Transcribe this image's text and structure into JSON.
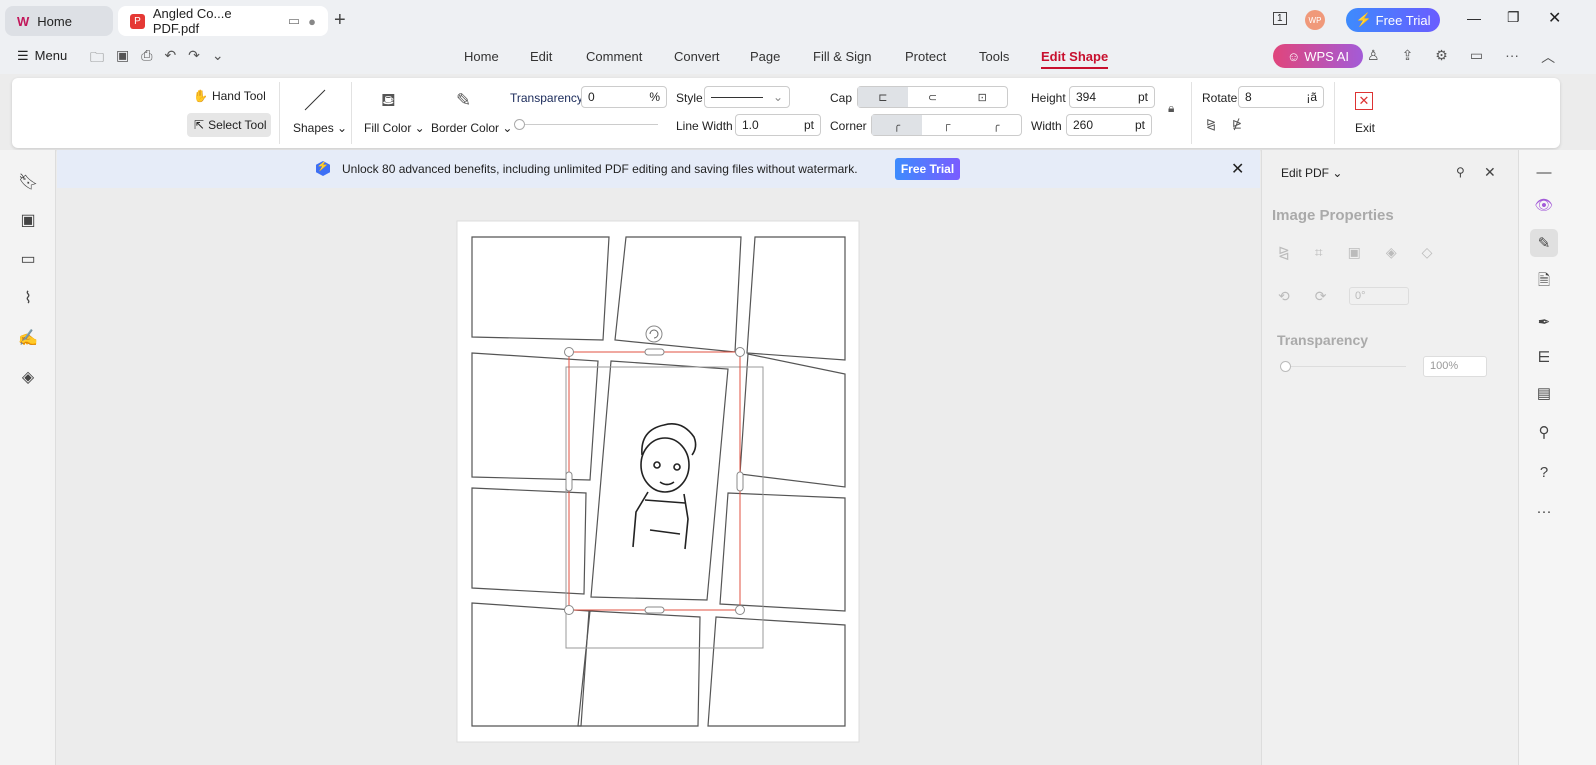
{
  "tabs": [
    {
      "label": "Home"
    },
    {
      "label": "Angled Co...e PDF.pdf"
    }
  ],
  "titlebar": {
    "free_trial": "Free Trial",
    "avatar": "WP",
    "page_indicator": "1"
  },
  "menu": {
    "menu_label": "Menu",
    "items": [
      "Home",
      "Edit",
      "Comment",
      "Convert",
      "Page",
      "Fill & Sign",
      "Protect",
      "Tools",
      "Edit Shape"
    ],
    "active": "Edit Shape",
    "wps_ai": "WPS AI"
  },
  "ribbon": {
    "hand_tool": "Hand Tool",
    "select_tool": "Select Tool",
    "shapes": "Shapes",
    "fill_color": "Fill Color",
    "border_color": "Border Color",
    "transparency_label": "Transparency",
    "transparency_value": "0",
    "transparency_unit": "%",
    "transparency_slider": 0,
    "style_label": "Style",
    "line_width_label": "Line Width",
    "line_width_value": "1.0",
    "line_width_unit": "pt",
    "cap_label": "Cap",
    "corner_label": "Corner",
    "height_label": "Height",
    "height_value": "394",
    "height_unit": "pt",
    "width_label": "Width",
    "width_value": "260",
    "width_unit": "pt",
    "rotate_label": "Rotate",
    "rotate_value": "8",
    "rotate_unit": "¡ã",
    "exit": "Exit"
  },
  "banner": {
    "text": "Unlock 80 advanced benefits, including unlimited PDF editing and saving files without watermark.",
    "button": "Free Trial"
  },
  "right_panel": {
    "title": "Edit PDF",
    "section": "Image Properties",
    "angle": "0°",
    "transparency_label": "Transparency",
    "transparency_value": "100%"
  },
  "colors": {
    "accent": "#c8102e",
    "free_trial": "#3d8bfd",
    "wps_ai": "#e0457b",
    "selection": "#e05040"
  }
}
